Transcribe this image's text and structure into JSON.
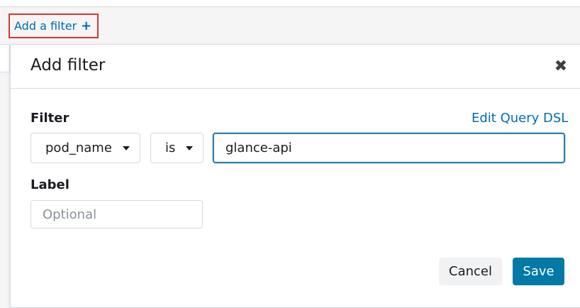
{
  "filter_bar": {
    "add_filter_label": "Add a filter",
    "add_filter_icon": "+"
  },
  "popover": {
    "title": "Add filter",
    "close_icon": "✖",
    "filter_label": "Filter",
    "edit_query_dsl": "Edit Query DSL",
    "field_select_value": "pod_name",
    "operator_select_value": "is",
    "value_input": "glance-api",
    "label_label": "Label",
    "label_placeholder": "Optional",
    "cancel_label": "Cancel",
    "save_label": "Save"
  },
  "colors": {
    "link": "#006bb4",
    "highlight_border": "#e0322d",
    "primary_button": "#0079a5",
    "focus_border": "#2e7fa8"
  }
}
